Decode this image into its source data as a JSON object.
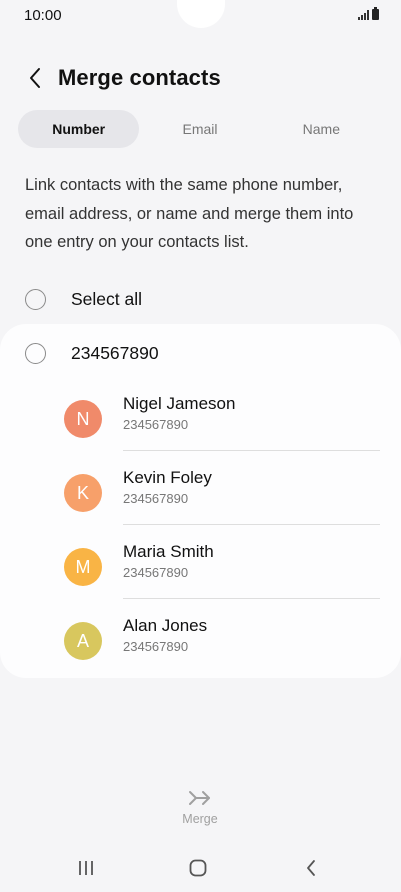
{
  "status_bar": {
    "time": "10:00"
  },
  "header": {
    "title": "Merge contacts",
    "back_icon": "chevron-left-icon"
  },
  "tabs": [
    {
      "label": "Number",
      "active": true
    },
    {
      "label": "Email",
      "active": false
    },
    {
      "label": "Name",
      "active": false
    }
  ],
  "description": "Link contacts with the same phone number, email address, or name and merge them into one entry on your contacts list.",
  "select_all": {
    "label": "Select all",
    "checked": false
  },
  "group": {
    "number": "234567890",
    "checked": false,
    "contacts": [
      {
        "initial": "N",
        "name": "Nigel Jameson",
        "number": "234567890",
        "color": "#f08a6a"
      },
      {
        "initial": "K",
        "name": "Kevin Foley",
        "number": "234567890",
        "color": "#f7a06a"
      },
      {
        "initial": "M",
        "name": "Maria Smith",
        "number": "234567890",
        "color": "#f9b445"
      },
      {
        "initial": "A",
        "name": "Alan Jones",
        "number": "234567890",
        "color": "#d8c75e"
      }
    ]
  },
  "merge": {
    "label": "Merge",
    "icon": "merge-arrow-icon"
  },
  "nav_bar": {
    "recents_icon": "recents-icon",
    "home_icon": "home-icon",
    "back_icon": "nav-back-icon"
  },
  "colors": {
    "background": "#f5f5f7",
    "card": "#fdfdfe",
    "active_tab": "#e6e6ea",
    "disabled": "#a0a0a0"
  }
}
